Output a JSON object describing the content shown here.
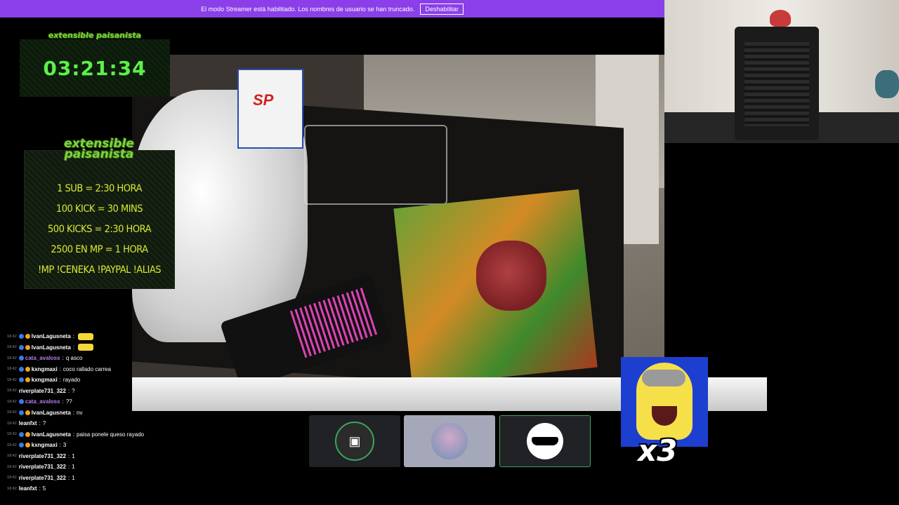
{
  "banner": {
    "message": "El modo Streamer está habilitado. Los nombres de usuario se han truncado.",
    "button_label": "Deshabilitar"
  },
  "timer": {
    "logo": "extensible paisanista",
    "value": "03:21:34"
  },
  "info_panel": {
    "logo": "extensible paisanista",
    "lines": [
      "1 SUB = 2:30 HORA",
      "100 KICK = 30 MINS",
      "500 KICKS = 2:30 HORA",
      "2500 EN MP = 1 HORA",
      "!MP !CENEKA !PAYPAL !ALIAS"
    ]
  },
  "emote_overlay": {
    "count": "x3"
  },
  "call_tiles": [
    {
      "icon": "camera-icon"
    },
    {
      "icon": "avatar-photo"
    },
    {
      "icon": "sunglasses-avatar"
    }
  ],
  "chat": {
    "messages": [
      {
        "time": "18:42",
        "user": "IvanLagusneta",
        "user_color": "#ffffff",
        "badges": [
          "a",
          "b"
        ],
        "text": "",
        "emote": true
      },
      {
        "time": "18:42",
        "user": "IvanLagusneta",
        "user_color": "#ffffff",
        "badges": [
          "a",
          "b"
        ],
        "text": "",
        "emote": true
      },
      {
        "time": "18:42",
        "user": "cata_avaloss",
        "user_color": "#b77cf0",
        "badges": [
          "a"
        ],
        "text": "q asco",
        "emote": false
      },
      {
        "time": "18:42",
        "user": "kxngmaxi",
        "user_color": "#ffffff",
        "badges": [
          "a",
          "b"
        ],
        "text": "coco rallado carrea",
        "emote": false
      },
      {
        "time": "18:42",
        "user": "kxngmaxi",
        "user_color": "#ffffff",
        "badges": [
          "a",
          "b"
        ],
        "text": "rayado",
        "emote": false
      },
      {
        "time": "18:42",
        "user": "riverplate731_322",
        "user_color": "#ffffff",
        "badges": [],
        "text": "?",
        "emote": false
      },
      {
        "time": "18:42",
        "user": "cata_avaloss",
        "user_color": "#b77cf0",
        "badges": [
          "a"
        ],
        "text": "??",
        "emote": false
      },
      {
        "time": "18:42",
        "user": "IvanLagusneta",
        "user_color": "#ffffff",
        "badges": [
          "a",
          "b"
        ],
        "text": "nv",
        "emote": false
      },
      {
        "time": "18:42",
        "user": "leanfxt",
        "user_color": "#ffffff",
        "badges": [],
        "text": "?",
        "emote": false
      },
      {
        "time": "18:42",
        "user": "IvanLagusneta",
        "user_color": "#ffffff",
        "badges": [
          "a",
          "b"
        ],
        "text": "paisa ponele queso rayado",
        "emote": false
      },
      {
        "time": "18:42",
        "user": "kxngmaxi",
        "user_color": "#ffffff",
        "badges": [
          "a",
          "b"
        ],
        "text": "3",
        "emote": false
      },
      {
        "time": "18:42",
        "user": "riverplate731_322",
        "user_color": "#ffffff",
        "badges": [],
        "text": "1",
        "emote": false
      },
      {
        "time": "18:42",
        "user": "riverplate731_322",
        "user_color": "#ffffff",
        "badges": [],
        "text": "1",
        "emote": false
      },
      {
        "time": "18:42",
        "user": "riverplate731_322",
        "user_color": "#ffffff",
        "badges": [],
        "text": "1",
        "emote": false
      },
      {
        "time": "18:42",
        "user": "leanfxt",
        "user_color": "#ffffff",
        "badges": [],
        "text": "5",
        "emote": false
      }
    ]
  },
  "colors": {
    "banner": "#8a3fe8",
    "timer": "#5cf04a",
    "info_text": "#d8ea30",
    "brand_green": "#7fd33c"
  }
}
